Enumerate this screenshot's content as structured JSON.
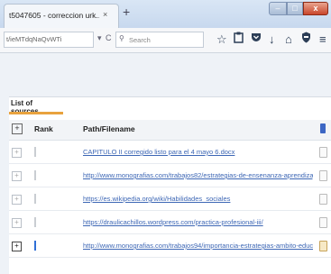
{
  "browser": {
    "tab_title": "t5047605 - correccion urk...",
    "tab_close": "×",
    "new_tab": "+",
    "window": {
      "minimize": "–",
      "maximize": "□",
      "close": "x"
    }
  },
  "toolbar": {
    "url_text": "t/ieMTdqNaQvWTi",
    "dropdown": "▾",
    "reload": "C",
    "search_placeholder": "Search",
    "icons": [
      "star-icon",
      "clipboard-icon",
      "pocket-icon",
      "download-icon",
      "home-icon",
      "shield-icon",
      "menu-icon"
    ]
  },
  "panel": {
    "tab_label": "List of sources",
    "header": {
      "expand": "+",
      "rank": "Rank",
      "path": "Path/Filename"
    },
    "rows": [
      {
        "path": "CAPITULO II corregido listo para el 4 mayo 6.docx",
        "selected": false
      },
      {
        "path": "http://www.monografias.com/trabajos82/estrategias-de-ensenanza-aprendizaje/estrategias-",
        "selected": false
      },
      {
        "path": "https://es.wikipedia.org/wiki/Habilidades_sociales",
        "selected": false
      },
      {
        "path": "https://draulicachillos.wordpress.com/practica-profesional-iii/",
        "selected": false
      },
      {
        "path": "http://www.monografias.com/trabajos94/importancia-estrategias-ambito-educativo/importa-",
        "selected": true
      }
    ]
  }
}
